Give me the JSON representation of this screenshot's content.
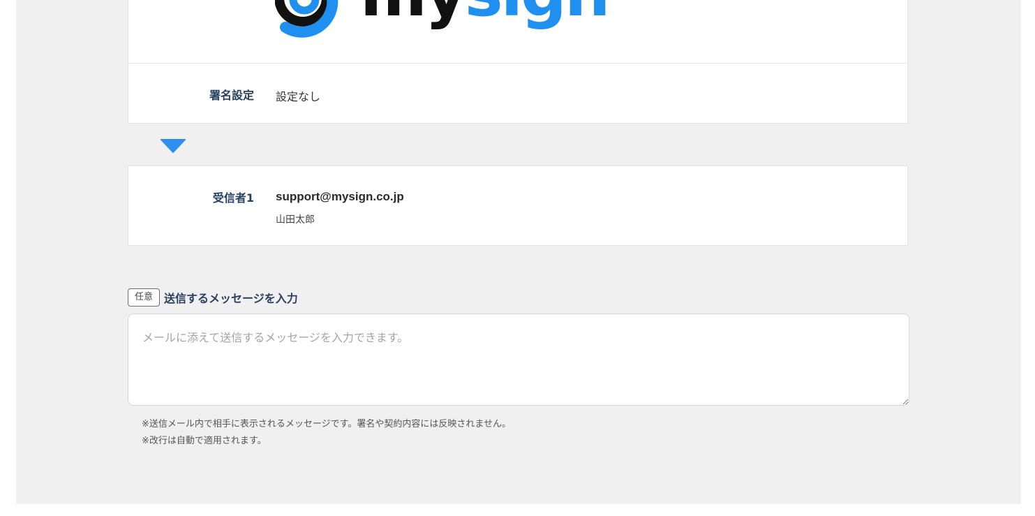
{
  "logo": {
    "text_dark": "my",
    "text_blue": "sign",
    "brand_blue": "#2090f0",
    "brand_dark": "#111111"
  },
  "signature_setting": {
    "label": "署名設定",
    "value": "設定なし"
  },
  "flow_arrow": {
    "icon": "triangle-down-icon",
    "color": "#2f8ff0"
  },
  "recipient": {
    "label": "受信者1",
    "email": "support@mysign.co.jp",
    "name": "山田太郎"
  },
  "message": {
    "badge": "任意",
    "title": "送信するメッセージを入力",
    "value": "",
    "placeholder": "メールに添えて送信するメッセージを入力できます。",
    "notes": [
      "※送信メール内で相手に表示されるメッセージです。署名や契約内容には反映されません。",
      "※改行は自動で適用されます。"
    ]
  }
}
